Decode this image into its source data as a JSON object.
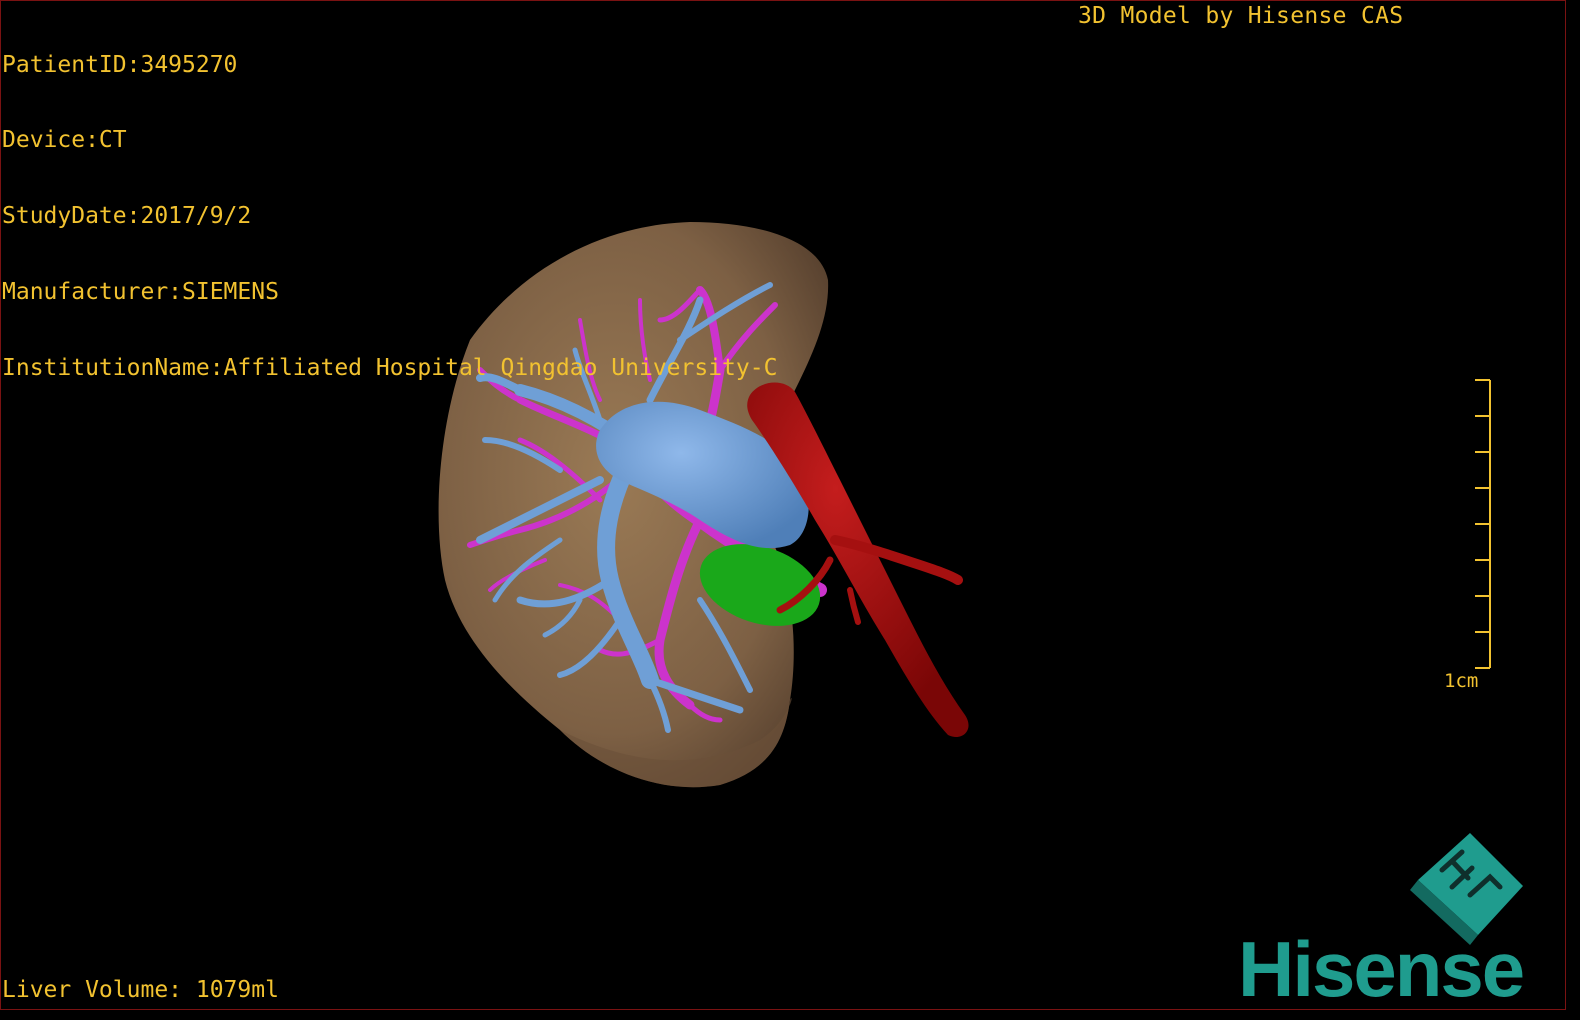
{
  "header": {
    "patient_id": "PatientID:3495270",
    "device": "Device:CT",
    "study_date": "StudyDate:2017/9/2",
    "manufacturer": "Manufacturer:SIEMENS",
    "institution": "InstitutionName:Affiliated Hospital Qingdao University-C"
  },
  "branding": {
    "model_credit": "3D Model by Hisense CAS",
    "logo_text": "Hisense",
    "logo_icon": "hisense-cube-icon"
  },
  "scale_bar": {
    "label": "1cm",
    "ticks": 9
  },
  "footer": {
    "liver_volume": "Liver Volume: 1079ml"
  },
  "colors": {
    "overlay_text": "#f2c230",
    "liver": "#8a6a48",
    "portal_vein": "#6f9fd6",
    "hepatic_artery": "#cc33cc",
    "aorta": "#a51010",
    "green_structure": "#1aa81a",
    "brand": "#1f9c8e"
  }
}
